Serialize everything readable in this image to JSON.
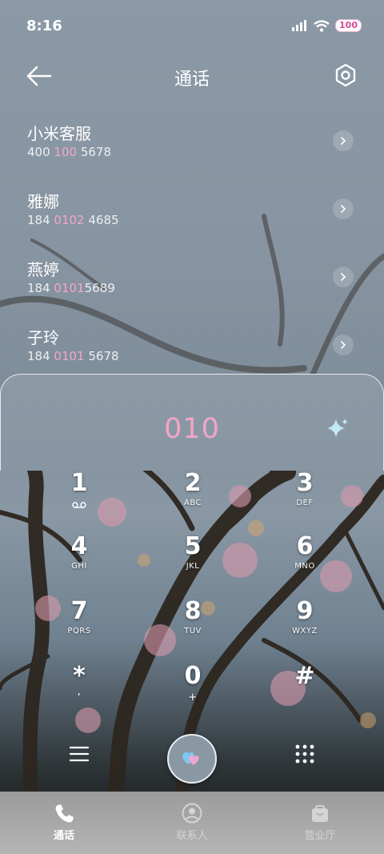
{
  "status": {
    "time": "8:16",
    "battery": "100"
  },
  "header": {
    "title": "通话"
  },
  "results": [
    {
      "name": "小米客服",
      "number_pre": "400 ",
      "number_hl": "100",
      "number_post": " 5678"
    },
    {
      "name": "雅娜",
      "number_pre": "184 ",
      "number_hl": "0102",
      "number_post": " 4685"
    },
    {
      "name": "燕婷",
      "number_pre": "184 ",
      "number_hl": "0101",
      "number_post": "5689"
    },
    {
      "name": "子玲",
      "number_pre": "184 ",
      "number_hl": "0101",
      "number_post": " 5678"
    }
  ],
  "dialer": {
    "input": "010",
    "keys": [
      {
        "digit": "1",
        "letters": ""
      },
      {
        "digit": "2",
        "letters": "ABC"
      },
      {
        "digit": "3",
        "letters": "DEF"
      },
      {
        "digit": "4",
        "letters": "GHI"
      },
      {
        "digit": "5",
        "letters": "JKL"
      },
      {
        "digit": "6",
        "letters": "MNO"
      },
      {
        "digit": "7",
        "letters": "PQRS"
      },
      {
        "digit": "8",
        "letters": "TUV"
      },
      {
        "digit": "9",
        "letters": "WXYZ"
      },
      {
        "digit": "*",
        "letters": ","
      },
      {
        "digit": "0",
        "letters": "+"
      },
      {
        "digit": "#",
        "letters": ""
      }
    ]
  },
  "nav": {
    "calls": "通话",
    "contacts": "联系人",
    "service": "营业厅"
  },
  "colors": {
    "highlight": "#f4a7c4",
    "accent": "#f2a6c4"
  },
  "icons": [
    "back-icon",
    "settings-icon",
    "chevron-right-icon",
    "sparkle-icon",
    "voicemail-icon",
    "menu-icon",
    "heart-icon",
    "keypad-icon",
    "phone-icon",
    "contact-icon",
    "bag-icon"
  ]
}
